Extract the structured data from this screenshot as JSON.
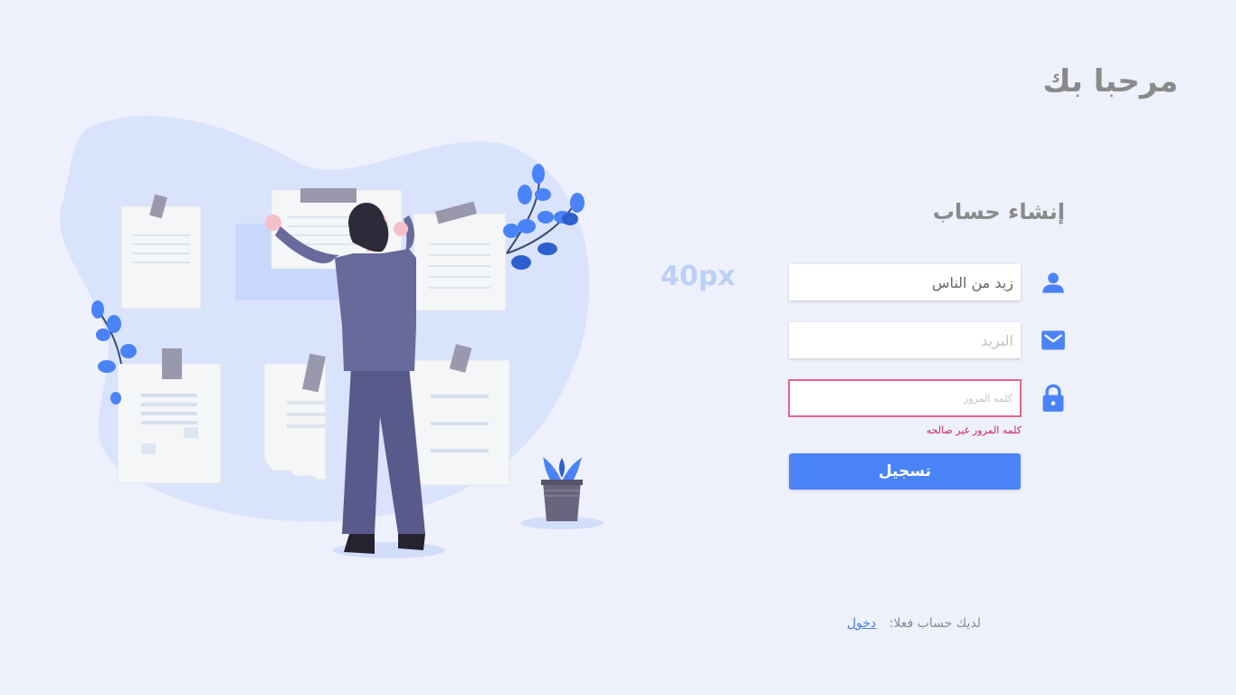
{
  "header": {
    "welcome": "مرحبا بك"
  },
  "decoration": {
    "size_label": "40px"
  },
  "form": {
    "title": "إنشاء حساب",
    "username": {
      "value": "زيد من الناس",
      "icon": "user-icon"
    },
    "email": {
      "value": "",
      "placeholder": "البريد",
      "icon": "mail-icon"
    },
    "password": {
      "value": "",
      "placeholder": "كلمه المرور",
      "icon": "lock-icon",
      "error": "كلمه المرور غير صالحه"
    },
    "submit_label": "تسجيل"
  },
  "footer": {
    "prompt": "لديك حساب فعلا:",
    "login_link": "دخول"
  },
  "colors": {
    "accent": "#4a83f7",
    "background": "#eef1fb",
    "error": "#d0245a",
    "title_gray": "#8a8a8a"
  }
}
